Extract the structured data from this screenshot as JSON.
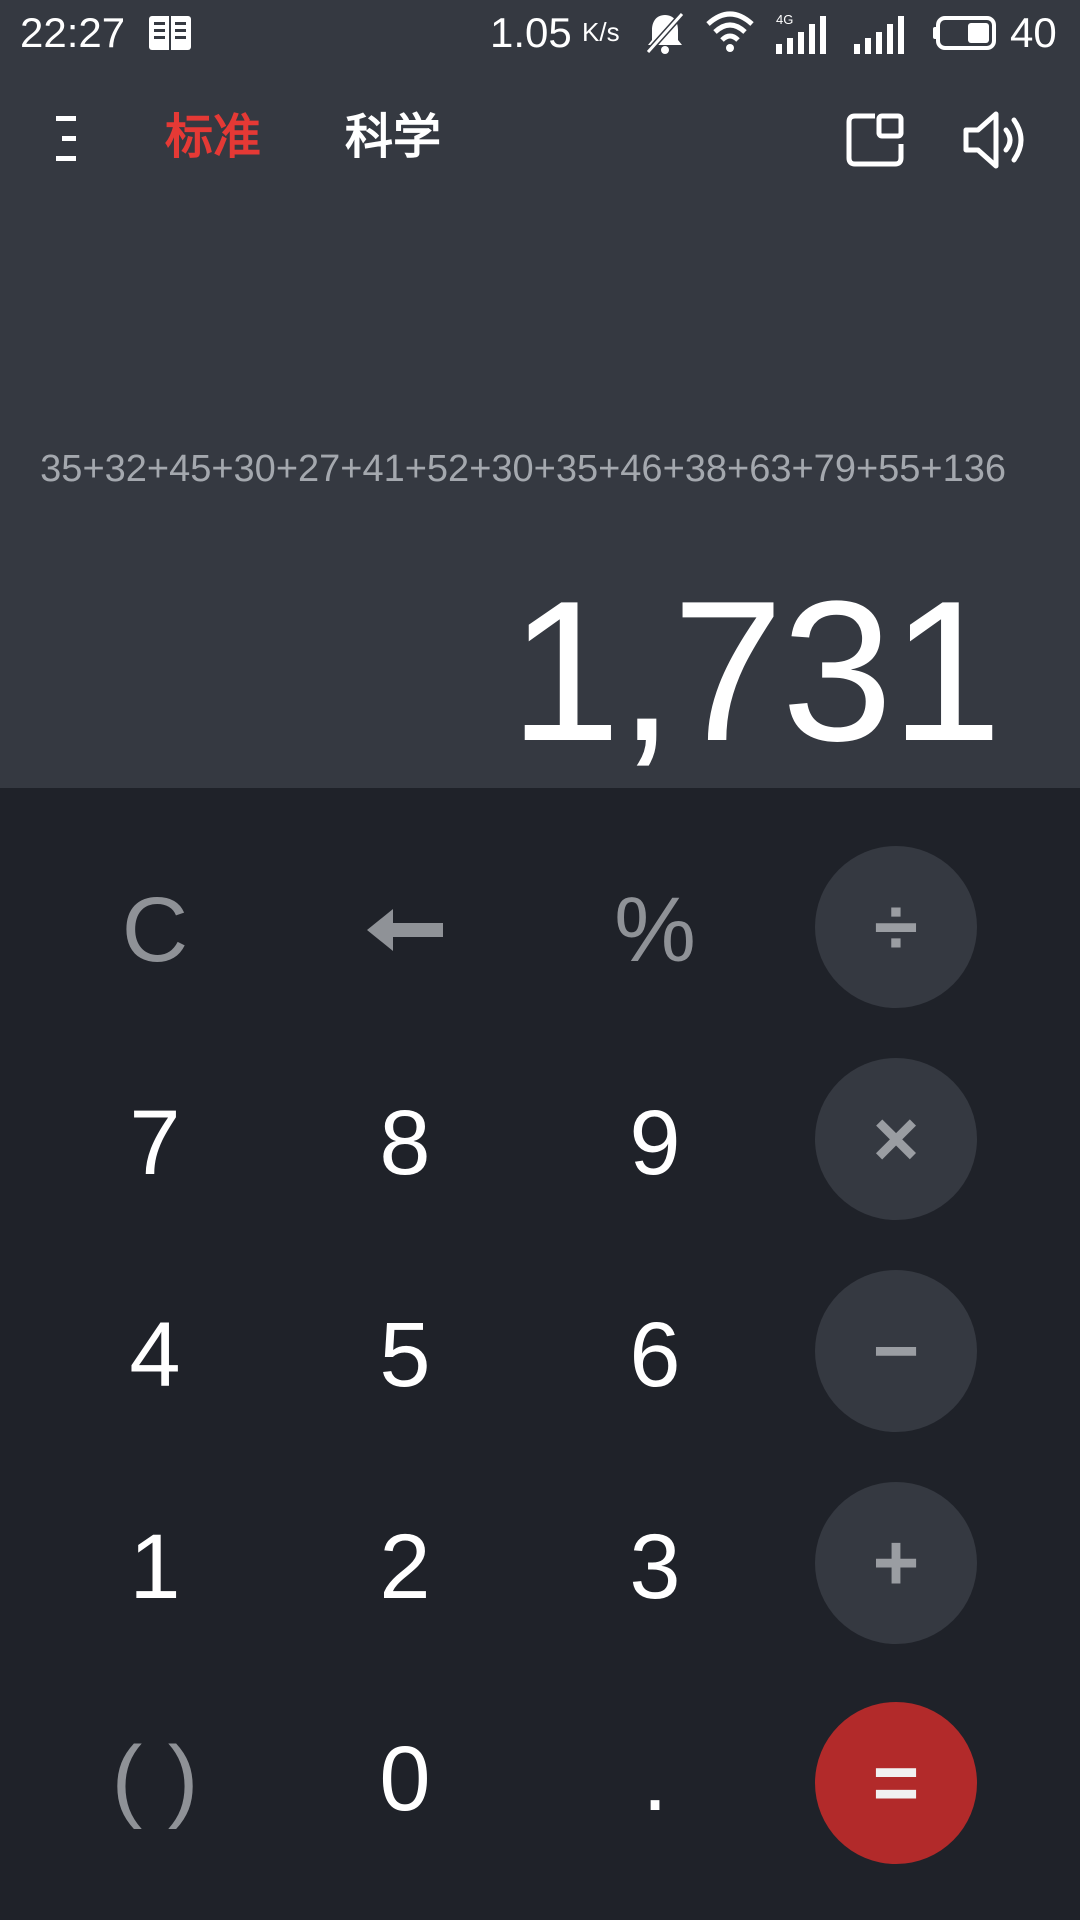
{
  "status_bar": {
    "time": "22:27",
    "net_speed": "1.05",
    "net_speed_unit": "K/s",
    "battery": "40",
    "network_label": "4G"
  },
  "toolbar": {
    "tabs": [
      {
        "label": "标准",
        "active": true
      },
      {
        "label": "科学",
        "active": false
      }
    ]
  },
  "display": {
    "expression": "35+32+45+30+27+41+52+30+35+46+38+63+79+55+136",
    "result": "1,731"
  },
  "keypad": {
    "row1": [
      "C",
      "←",
      "%",
      "÷"
    ],
    "row2": [
      "7",
      "8",
      "9",
      "×"
    ],
    "row3": [
      "4",
      "5",
      "6",
      "−"
    ],
    "row4": [
      "1",
      "2",
      "3",
      "+"
    ],
    "row5": [
      "( )",
      "0",
      ".",
      "="
    ]
  },
  "colors": {
    "accent": "#e53935",
    "display_bg": "#353941",
    "keypad_bg": "#1f2229",
    "equals_bg": "#b22a2a"
  }
}
